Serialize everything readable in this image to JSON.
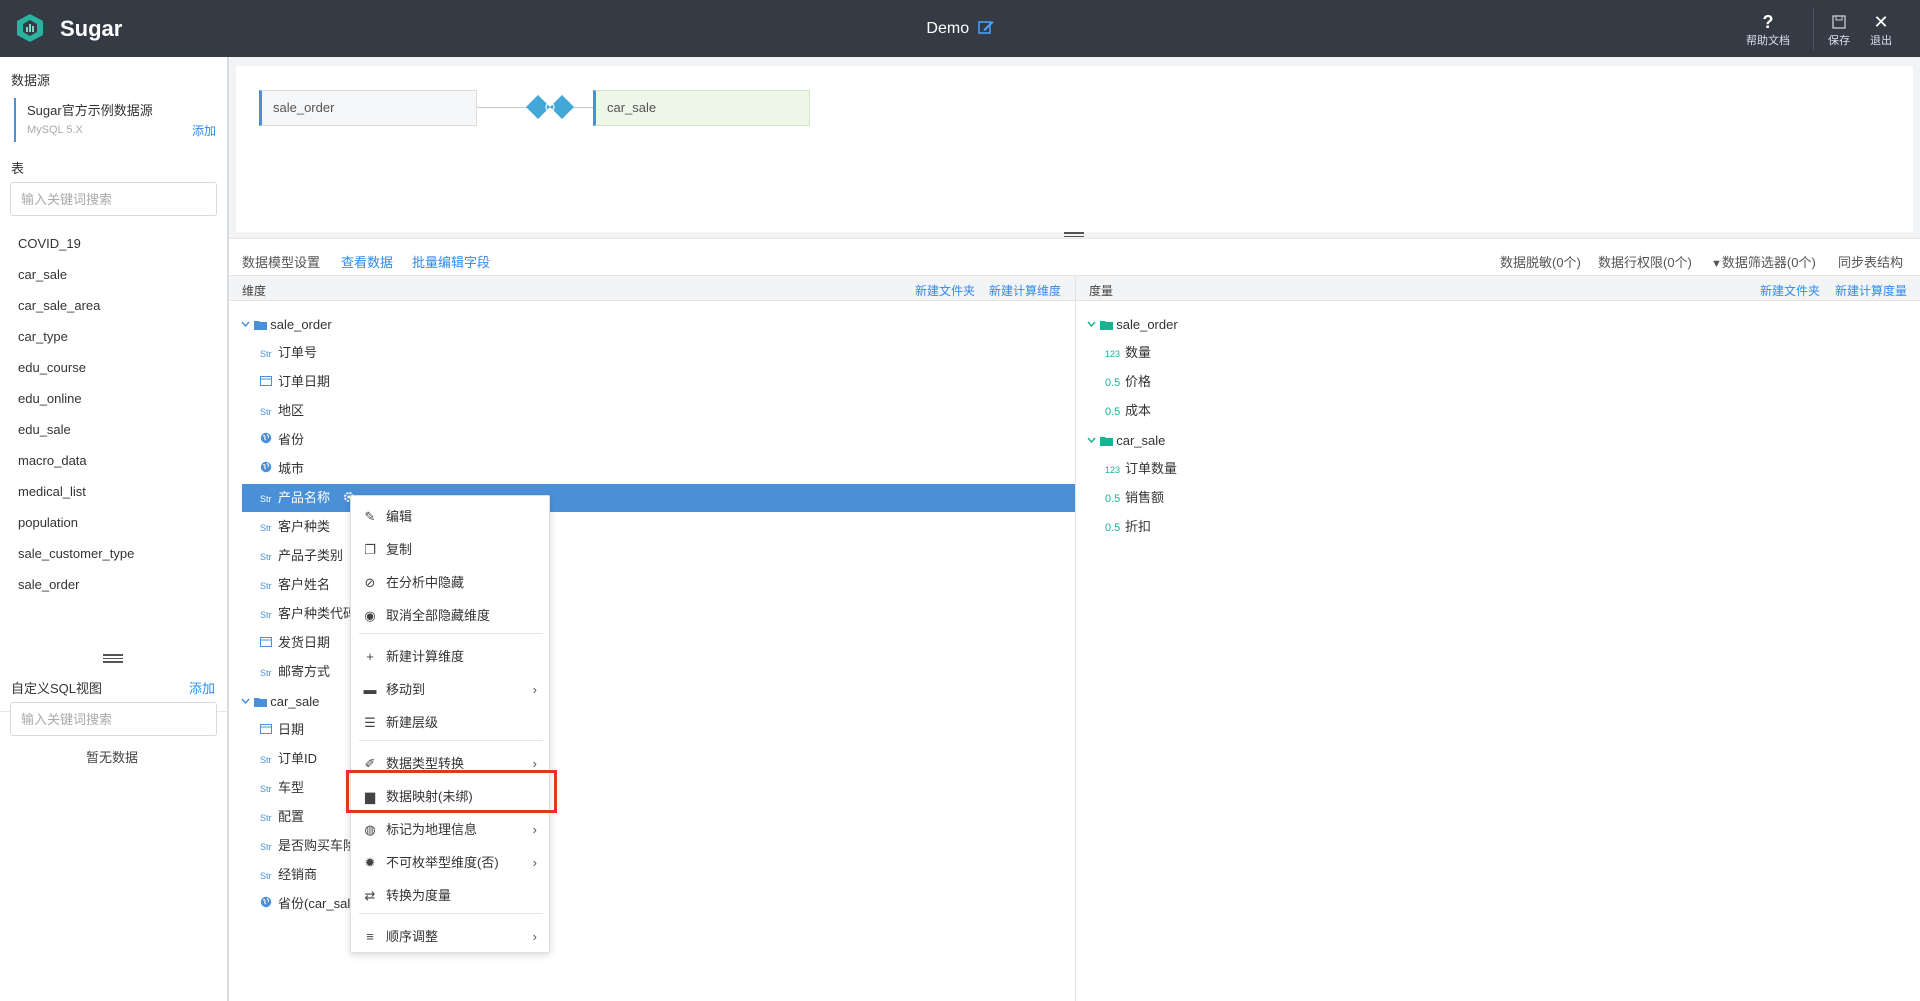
{
  "header": {
    "brand": "Sugar",
    "title": "Demo",
    "help_label": "帮助文档",
    "save_label": "保存",
    "exit_label": "退出"
  },
  "sidebar": {
    "datasource_title": "数据源",
    "datasource": {
      "name": "Sugar官方示例数据源",
      "version": "MySQL 5.X",
      "add_label": "添加"
    },
    "tables_title": "表",
    "table_search_placeholder": "输入关键词搜索",
    "tables": [
      "COVID_19",
      "car_sale",
      "car_sale_area",
      "car_type",
      "edu_course",
      "edu_online",
      "edu_sale",
      "macro_data",
      "medical_list",
      "population",
      "sale_customer_type",
      "sale_order"
    ],
    "sql_title": "自定义SQL视图",
    "sql_add_label": "添加",
    "sql_search_placeholder": "输入关键词搜索",
    "sql_empty": "暂无数据"
  },
  "canvas": {
    "left_table": "sale_order",
    "right_table": "car_sale"
  },
  "toolbar": {
    "tabs": [
      "数据模型设置",
      "查看数据",
      "批量编辑字段"
    ],
    "right_items": [
      "数据脱敏(0个)",
      "数据行权限(0个)",
      "数据筛选器(0个)",
      "同步表结构"
    ]
  },
  "dimensions": {
    "header": "维度",
    "new_folder": "新建文件夹",
    "new_calc": "新建计算维度",
    "groups": [
      {
        "name": "sale_order",
        "fields": [
          {
            "type": "Str",
            "name": "订单号"
          },
          {
            "type": "date",
            "name": "订单日期"
          },
          {
            "type": "Str",
            "name": "地区"
          },
          {
            "type": "geo",
            "name": "省份"
          },
          {
            "type": "geo",
            "name": "城市"
          },
          {
            "type": "Str",
            "name": "产品名称"
          },
          {
            "type": "Str",
            "name": "客户种类"
          },
          {
            "type": "Str",
            "name": "产品子类别"
          },
          {
            "type": "Str",
            "name": "客户姓名"
          },
          {
            "type": "Str",
            "name": "客户种类代码"
          },
          {
            "type": "date",
            "name": "发货日期"
          },
          {
            "type": "Str",
            "name": "邮寄方式"
          }
        ]
      },
      {
        "name": "car_sale",
        "fields": [
          {
            "type": "date",
            "name": "日期"
          },
          {
            "type": "Str",
            "name": "订单ID"
          },
          {
            "type": "Str",
            "name": "车型"
          },
          {
            "type": "Str",
            "name": "配置"
          },
          {
            "type": "Str",
            "name": "是否购买车险"
          },
          {
            "type": "Str",
            "name": "经销商"
          },
          {
            "type": "geo",
            "name": "省份(car_sale)"
          }
        ]
      }
    ]
  },
  "measures": {
    "header": "度量",
    "new_folder": "新建文件夹",
    "new_calc": "新建计算度量",
    "groups": [
      {
        "name": "sale_order",
        "fields": [
          {
            "type": "123",
            "name": "数量"
          },
          {
            "type": "0.5",
            "name": "价格"
          },
          {
            "type": "0.5",
            "name": "成本"
          }
        ]
      },
      {
        "name": "car_sale",
        "fields": [
          {
            "type": "123",
            "name": "订单数量"
          },
          {
            "type": "0.5",
            "name": "销售额"
          },
          {
            "type": "0.5",
            "name": "折扣"
          }
        ]
      }
    ]
  },
  "context_menu": {
    "items": [
      {
        "icon": "edit-icon",
        "label": "编辑"
      },
      {
        "icon": "copy-icon",
        "label": "复制"
      },
      {
        "icon": "eye-off-icon",
        "label": "在分析中隐藏"
      },
      {
        "icon": "eye-icon",
        "label": "取消全部隐藏维度"
      },
      {
        "icon": "plus-icon",
        "label": "新建计算维度"
      },
      {
        "icon": "folder-icon",
        "label": "移动到"
      },
      {
        "icon": "hierarchy-icon",
        "label": "新建层级"
      },
      {
        "icon": "wand-icon",
        "label": "数据类型转换"
      },
      {
        "icon": "book-icon",
        "label": "数据映射(未绑)"
      },
      {
        "icon": "globe-icon",
        "label": "标记为地理信息"
      },
      {
        "icon": "gear-icon",
        "label": "不可枚举型维度(否)"
      },
      {
        "icon": "swap-icon",
        "label": "转换为度量"
      },
      {
        "icon": "list-icon",
        "label": "顺序调整"
      }
    ]
  },
  "colors": {
    "topbar": "#353b45",
    "accent": "#4a90d9",
    "highlight": "#e5332a",
    "measure": "#19b393"
  }
}
